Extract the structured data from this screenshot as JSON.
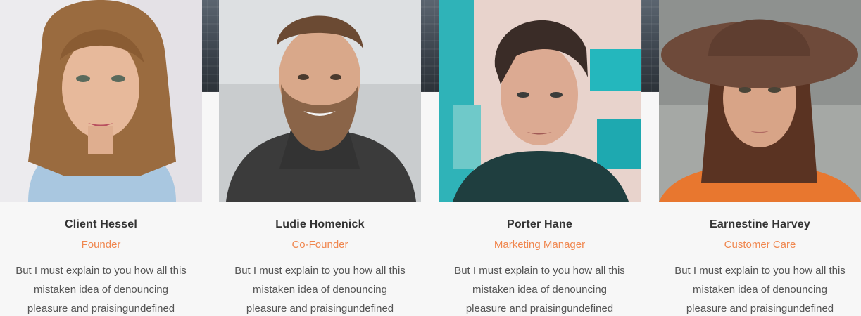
{
  "team": {
    "accent_color": "#f0874f",
    "members": [
      {
        "name": "Client Hessel",
        "role": "Founder",
        "photo_icon": "woman-portrait-photo",
        "bio_lines": [
          "But I must explain to you how all this",
          "mistaken idea of denouncing",
          "pleasure and praisingundefined"
        ]
      },
      {
        "name": "Ludie Homenick",
        "role": "Co-Founder",
        "photo_icon": "bearded-man-portrait-photo",
        "bio_lines": [
          "But I must explain to you how all this",
          "mistaken idea of denouncing",
          "pleasure and praisingundefined"
        ]
      },
      {
        "name": "Porter Hane",
        "role": "Marketing Manager",
        "photo_icon": "young-man-portrait-photo",
        "bio_lines": [
          "But I must explain to you how all this",
          "mistaken idea of denouncing",
          "pleasure and praisingundefined"
        ]
      },
      {
        "name": "Earnestine Harvey",
        "role": "Customer Care",
        "photo_icon": "woman-hat-portrait-photo",
        "bio_lines": [
          "But I must explain to you how all this",
          "mistaken idea of denouncing",
          "pleasure and praisingundefined"
        ]
      }
    ]
  }
}
